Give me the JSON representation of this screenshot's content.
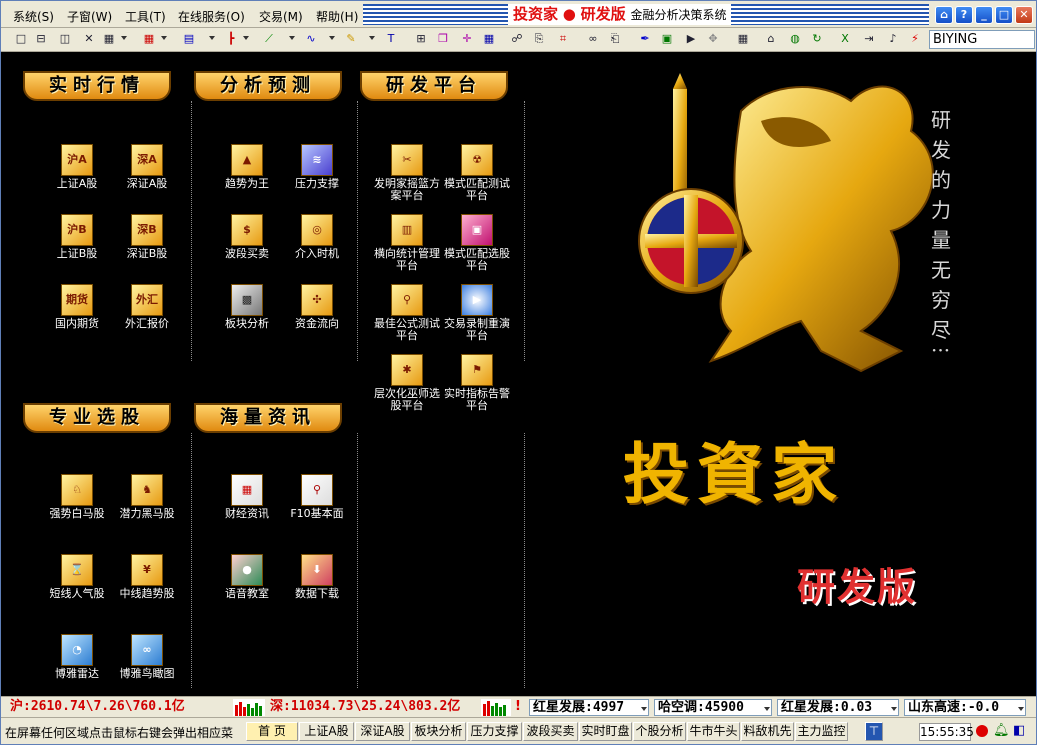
{
  "menu": {
    "items": [
      "系统(S)",
      "子窗(W)",
      "工具(T)",
      "在线服务(O)",
      "交易(M)",
      "帮助(H)"
    ]
  },
  "title": {
    "brand": "投资家",
    "edition": "研发版",
    "subtitle": "金融分析决策系统"
  },
  "toolbar": {
    "code_input": "BIYING"
  },
  "sections": {
    "realtime": {
      "title": "实时行情",
      "items": [
        {
          "icon_text": "沪A",
          "label": "上证A股"
        },
        {
          "icon_text": "深A",
          "label": "深证A股"
        },
        {
          "icon_text": "沪B",
          "label": "上证B股"
        },
        {
          "icon_text": "深B",
          "label": "深证B股"
        },
        {
          "icon_text": "期货",
          "label": "国内期货"
        },
        {
          "icon_text": "外汇",
          "label": "外汇报价"
        }
      ]
    },
    "forecast": {
      "title": "分析预测",
      "items": [
        {
          "label": "趋势为王"
        },
        {
          "label": "压力支撑"
        },
        {
          "label": "波段买卖"
        },
        {
          "label": "介入时机"
        },
        {
          "label": "板块分析"
        },
        {
          "label": "资金流向"
        }
      ]
    },
    "research": {
      "title": "研发平台",
      "items": [
        {
          "label": "发明家摇篮方案平台"
        },
        {
          "label": "模式匹配测试平台"
        },
        {
          "label": "横向统计管理平台"
        },
        {
          "label": "模式匹配选股平台"
        },
        {
          "label": "最佳公式测试平台"
        },
        {
          "label": "交易录制重演平台"
        },
        {
          "label": "层次化巫师选股平台"
        },
        {
          "label": "实时指标告警平台"
        }
      ]
    },
    "picking": {
      "title": "专业选股",
      "items": [
        {
          "label": "强势白马股"
        },
        {
          "label": "潜力黑马股"
        },
        {
          "label": "短线人气股"
        },
        {
          "label": "中线趋势股"
        },
        {
          "label": "博雅雷达"
        },
        {
          "label": "博雅鸟瞰图"
        }
      ]
    },
    "news": {
      "title": "海量资讯",
      "items": [
        {
          "label": "财经资讯"
        },
        {
          "label": "F10基本面"
        },
        {
          "label": "语音教室"
        },
        {
          "label": "数据下载"
        }
      ]
    }
  },
  "splash": {
    "poem": "研发的力量无穷尽",
    "poem_tail": "···",
    "big_title": "投資家",
    "edition": "研发版"
  },
  "status": {
    "sh_quote": "沪:2610.74\\7.26\\760.1亿",
    "sz_quote": "深:11034.73\\25.24\\803.2亿",
    "ticker1": "红星发展:4997",
    "ticker2": "哈空调:45900",
    "ticker3": "红星发展:0.03",
    "ticker4": "山东高速:-0.0"
  },
  "bottom": {
    "hint": "在屏幕任何区域点击鼠标右键会弹出相应菜",
    "tabs": [
      "首 页",
      "上证A股",
      "深证A股",
      "板块分析",
      "压力支撑",
      "波段买卖",
      "实时盯盘",
      "个股分析",
      "牛市牛头",
      "料敌机先",
      "主力监控"
    ],
    "clock": "15:55:35"
  },
  "colors": {
    "accent_gold": "#f0b400",
    "title_red": "#e01010",
    "background": "#000000"
  }
}
